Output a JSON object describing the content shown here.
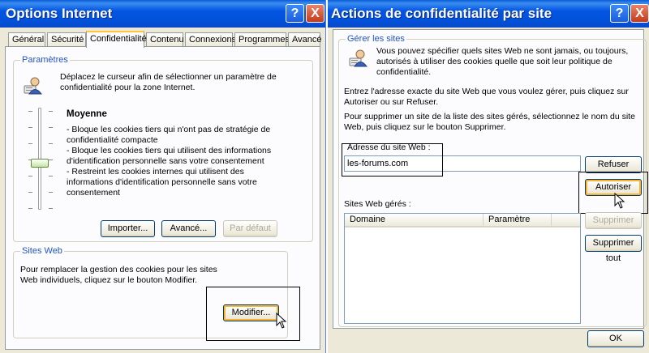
{
  "win1": {
    "title": "Options Internet",
    "tabs": [
      "Général",
      "Sécurité",
      "Confidentialité",
      "Contenu",
      "Connexions",
      "Programmes",
      "Avancé"
    ],
    "settings": {
      "label": "Paramètres",
      "intro": "Déplacez le curseur afin de sélectionner un paramètre de confidentialité pour la zone Internet.",
      "level_title": "Moyenne",
      "bullets": [
        "- Bloque les cookies tiers qui n'ont pas de stratégie de confidentialité compacte",
        "- Bloque les cookies tiers qui utilisent des informations d'identification personnelle sans votre consentement",
        "- Restreint les cookies internes qui utilisent des informations d'identification personnelle sans votre consentement"
      ],
      "import_label": "Importer...",
      "advanced_label": "Avancé...",
      "default_label": "Par défaut"
    },
    "sites": {
      "label": "Sites Web",
      "text": "Pour remplacer la gestion des cookies pour les sites Web individuels, cliquez sur le bouton Modifier.",
      "modify_label": "Modifier..."
    }
  },
  "win2": {
    "title": "Actions de confidentialité par site",
    "manage_label": "Gérer les sites",
    "intro": "Vous pouvez spécifier quels sites Web ne sont jamais, ou toujours, autorisés à utiliser des cookies quelle que soit leur politique de confidentialité.",
    "para1": "Entrez l'adresse exacte du site Web que vous voulez gérer, puis cliquez sur Autoriser ou sur Refuser.",
    "para2": "Pour supprimer un site de la liste des sites gérés, sélectionnez le nom du site Web, puis cliquez sur le bouton Supprimer.",
    "address_label": "Adresse du site Web :",
    "address_value": "les-forums.com",
    "refuse_label": "Refuser",
    "allow_label": "Autoriser",
    "managed_label": "Sites Web gérés :",
    "col_domain": "Domaine",
    "col_setting": "Paramètre",
    "delete_label": "Supprimer",
    "delete_all_label": "Supprimer tout",
    "ok_label": "OK"
  },
  "icons": {
    "help": "?",
    "close": "X"
  },
  "colors": {
    "title_blue": "#0254e2",
    "group_label": "#2255cc",
    "close_red": "#c8391a"
  }
}
